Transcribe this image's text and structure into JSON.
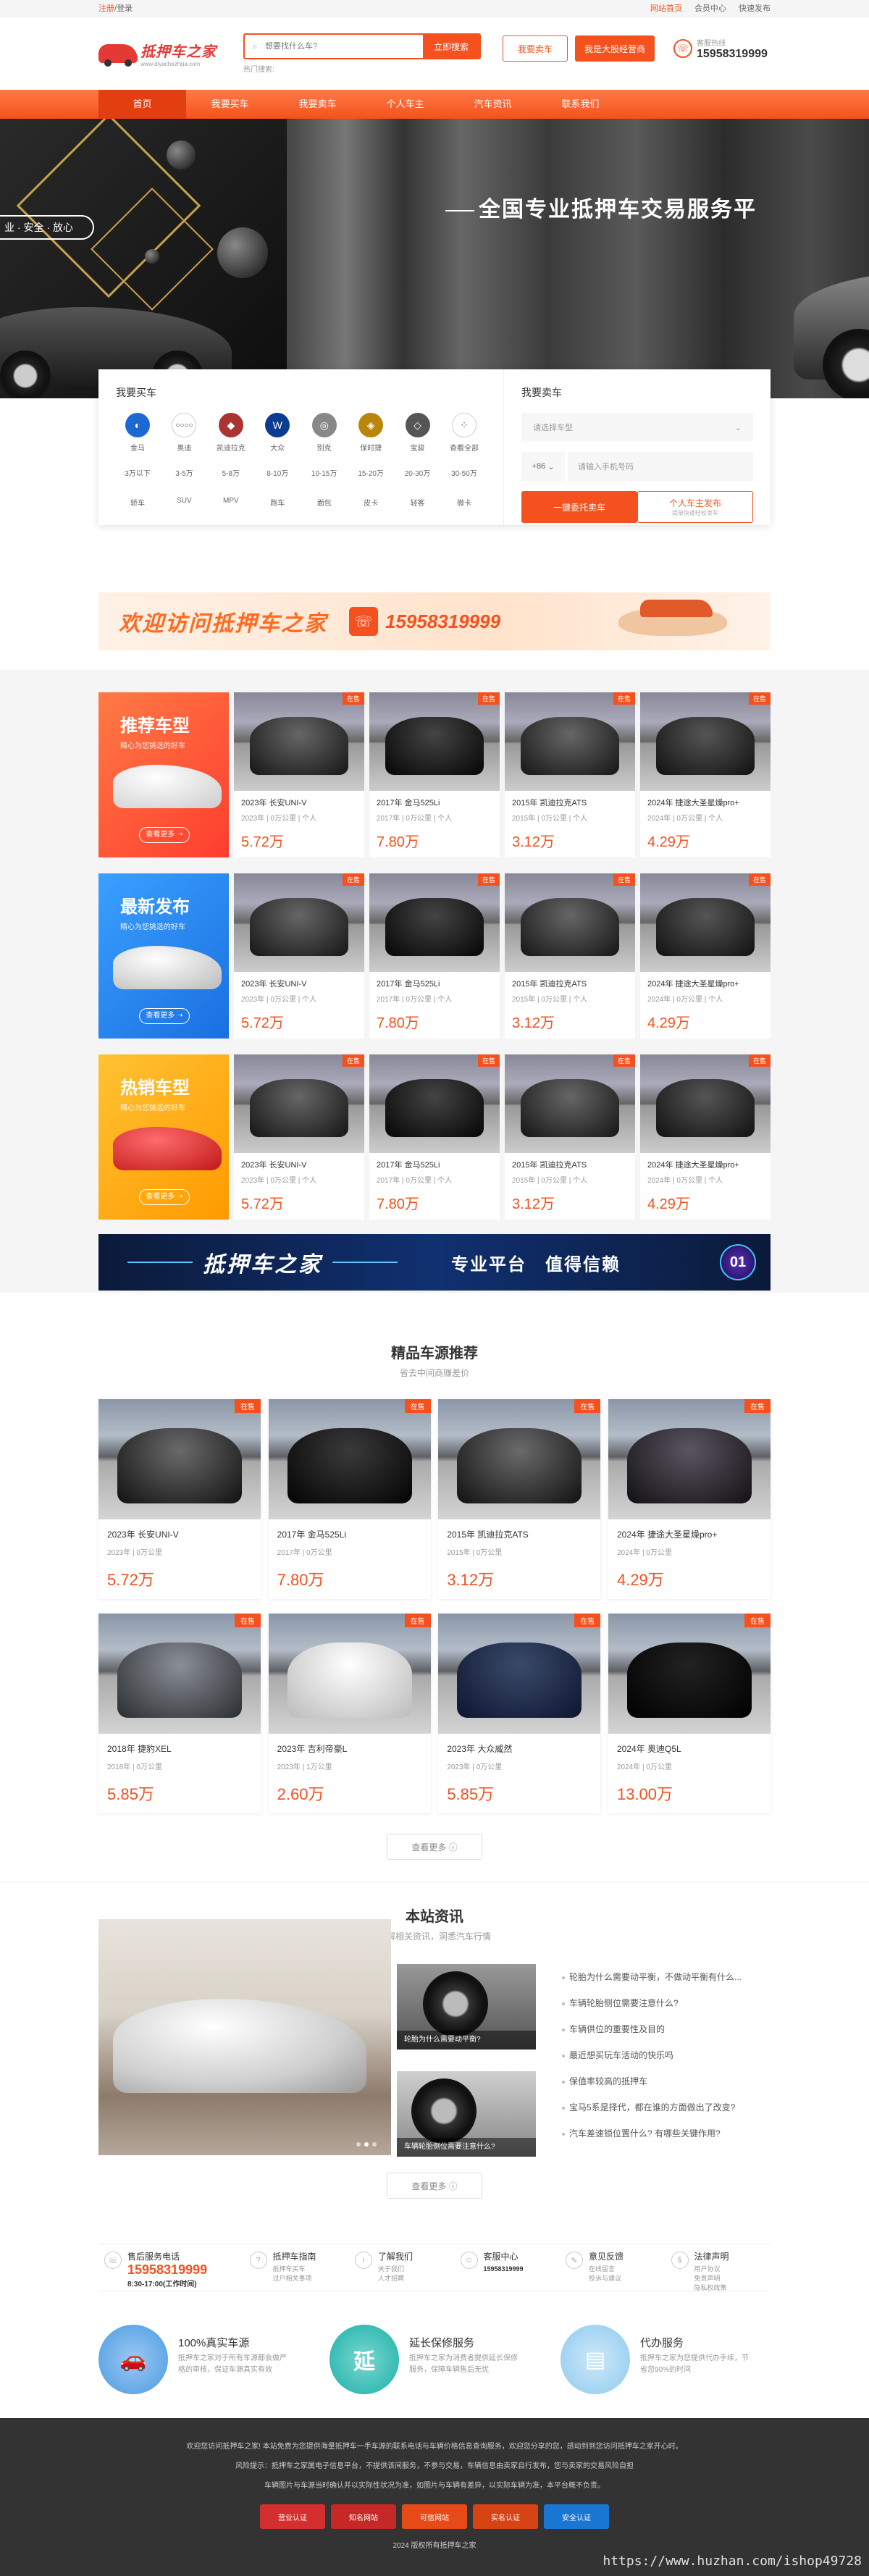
{
  "topbar": {
    "login": "注册",
    "sep": "/",
    "login2": "登录",
    "links": [
      "网站首页",
      "会员中心",
      "快速发布"
    ]
  },
  "header": {
    "logo_name": "抵押车之家",
    "logo_domain": "www.diyachezhijia.com",
    "search_placeholder": "想要找什么车?",
    "search_button": "立即搜索",
    "hot_label": "热门搜索:",
    "btn_buy": "我要卖车",
    "btn_join": "我是大股经营商",
    "hotline_label": "客服热线",
    "hotline_number": "15958319999"
  },
  "nav": [
    "首页",
    "我要买车",
    "我要卖车",
    "个人车主",
    "汽车资讯",
    "联系我们"
  ],
  "banner": {
    "tag": "业 · 安全 · 放心",
    "slogan": "全国专业抵押车交易服务平"
  },
  "buy": {
    "title": "我要买车",
    "brands": [
      "金马",
      "奥迪",
      "凯迪拉克",
      "大众",
      "别克",
      "保时捷",
      "宝骏",
      "查看全部"
    ],
    "prices": [
      "3万以下",
      "3-5万",
      "5-8万",
      "8-10万",
      "10-15万",
      "15-20万",
      "20-30万",
      "30-50万"
    ],
    "types": [
      "轿车",
      "SUV",
      "MPV",
      "跑车",
      "面包",
      "皮卡",
      "轻客",
      "微卡"
    ]
  },
  "sell": {
    "title": "我要卖车",
    "brand_placeholder": "请选择车型",
    "country_code": "+86",
    "phone_placeholder": "请输入手机号码",
    "btn_sell": "一键委托卖车",
    "btn_publish": "个人车主发布",
    "btn_publish_sub": "简单快速轻松卖车"
  },
  "ad1": {
    "text": "欢迎访问抵押车之家",
    "phone": "15958319999"
  },
  "categories": [
    {
      "title": "推荐车型",
      "sub": "精心为您挑选的好车",
      "link": "查看更多 ➝",
      "color": "#ff5a3c"
    },
    {
      "title": "最新发布",
      "sub": "精心为您挑选的好车",
      "link": "查看更多 ➝",
      "color": "#2a8cf0"
    },
    {
      "title": "热销车型",
      "sub": "精心为您挑选的好车",
      "link": "查看更多 ➝",
      "color": "#ffb020"
    }
  ],
  "small_cars": [
    {
      "title": "2023年 长安UNI-V",
      "meta": "2023年 | 0万公里 | 个人",
      "price": "5.72万",
      "badge": "在售"
    },
    {
      "title": "2017年 金马525Li",
      "meta": "2017年 | 0万公里 | 个人",
      "price": "7.80万",
      "badge": "在售"
    },
    {
      "title": "2015年 凯迪拉克ATS",
      "meta": "2015年 | 0万公里 | 个人",
      "price": "3.12万",
      "badge": "在售"
    },
    {
      "title": "2024年 捷途大圣星燥pro+",
      "meta": "2024年 | 0万公里 | 个人",
      "price": "4.29万",
      "badge": "在售"
    }
  ],
  "ad2": {
    "t1": "抵押车之家",
    "t2": "专业平台",
    "t3": "值得信赖",
    "num": "01"
  },
  "recommend": {
    "title": "精品车源推荐",
    "sub": "省去中间商赚差价",
    "row1": [
      {
        "title": "2023年 长安UNI-V",
        "meta": "2023年 | 0万公里",
        "price": "5.72万",
        "badge": "在售"
      },
      {
        "title": "2017年 金马525Li",
        "meta": "2017年 | 0万公里",
        "price": "7.80万",
        "badge": "在售"
      },
      {
        "title": "2015年 凯迪拉克ATS",
        "meta": "2015年 | 0万公里",
        "price": "3.12万",
        "badge": "在售"
      },
      {
        "title": "2024年 捷途大圣星燥pro+",
        "meta": "2024年 | 0万公里",
        "price": "4.29万",
        "badge": "在售"
      }
    ],
    "row2": [
      {
        "title": "2018年 捷豹XEL",
        "meta": "2018年 | 0万公里",
        "price": "5.85万",
        "badge": "在售"
      },
      {
        "title": "2023年 吉利帝豪L",
        "meta": "2023年 | 1万公里",
        "price": "2.60万",
        "badge": "在售"
      },
      {
        "title": "2023年 大众威然",
        "meta": "2023年 | 0万公里",
        "price": "5.85万",
        "badge": "在售"
      },
      {
        "title": "2024年 奥迪Q5L",
        "meta": "2024年 | 0万公里",
        "price": "13.00万",
        "badge": "在售"
      }
    ],
    "more": "查看更多 ⓘ"
  },
  "news": {
    "title": "本站资讯",
    "sub": "了解相关资讯，洞悉汽车行情",
    "small1": "轮胎为什么需要动平衡?",
    "small2": "车辆轮胎侧位需要注意什么?",
    "list": [
      "轮胎为什么需要动平衡，不做动平衡有什么...",
      "车辆轮胎侧位需要注意什么?",
      "车辆供位的重要性及目的",
      "最近想买玩车活动的快乐吗",
      "保值率较高的抵押车",
      "宝马5系是择代，都在谁的方面做出了改变?",
      "汽车差速锁位置什么? 有哪些关键作用?"
    ],
    "more": "查看更多 ⓘ"
  },
  "service": [
    {
      "title": "售后服务电话",
      "big": "15958319999",
      "hours": "8:30-17:00(工作时间)"
    },
    {
      "title": "抵押车指南",
      "desc": "抵押车买车\n过户相关事项"
    },
    {
      "title": "了解我们",
      "desc": "关于我们\n人才招聘"
    },
    {
      "title": "客服中心",
      "desc": "15958319999"
    },
    {
      "title": "意见反馈",
      "desc": "在线留言\n投诉与建议"
    },
    {
      "title": "法律声明",
      "desc": "用户协议\n免责声明\n隐私权政策"
    }
  ],
  "features": [
    {
      "title": "100%真实车源",
      "desc": "抵押车之家对于所有车源都会做严格的审核，保证车源真实有效",
      "color": "#4a9be0"
    },
    {
      "title": "延长保修服务",
      "desc": "抵押车之家为消费者提供延长保修服务，保障车辆售后无忧",
      "color": "#1ab0a8"
    },
    {
      "title": "代办服务",
      "desc": "抵押车之家为您提供代办手续，节省您90%的时间",
      "color": "#5ab0e6"
    }
  ],
  "footer": {
    "line1": "欢迎您访问抵押车之家! 本站免费为您提供海量抵押车一手车源的联系电话与车辆价格信息查询服务，欢迎您分享的您，感动到到您访问抵押车之家开心时。",
    "line2": "风险提示：抵押车之家属电子信息平台，不提供该间服务，不参与交易，车辆信息由卖家自行发布，您与卖家的交易风险自担",
    "line3": "车辆图片与车源当时确认并以实际性状况为准，如图片与车辆有差异，以实际车辆为准，本平台概不负责。",
    "badges": [
      "营业认证",
      "知名网站",
      "可信网站",
      "实名认证",
      "安全认证"
    ],
    "copyright": "2024 版权所有抵押车之家",
    "watermark": "https://www.huzhan.com/ishop49728"
  },
  "colors": {
    "accent": "#f4511e",
    "nav_active": "#e23f10"
  }
}
